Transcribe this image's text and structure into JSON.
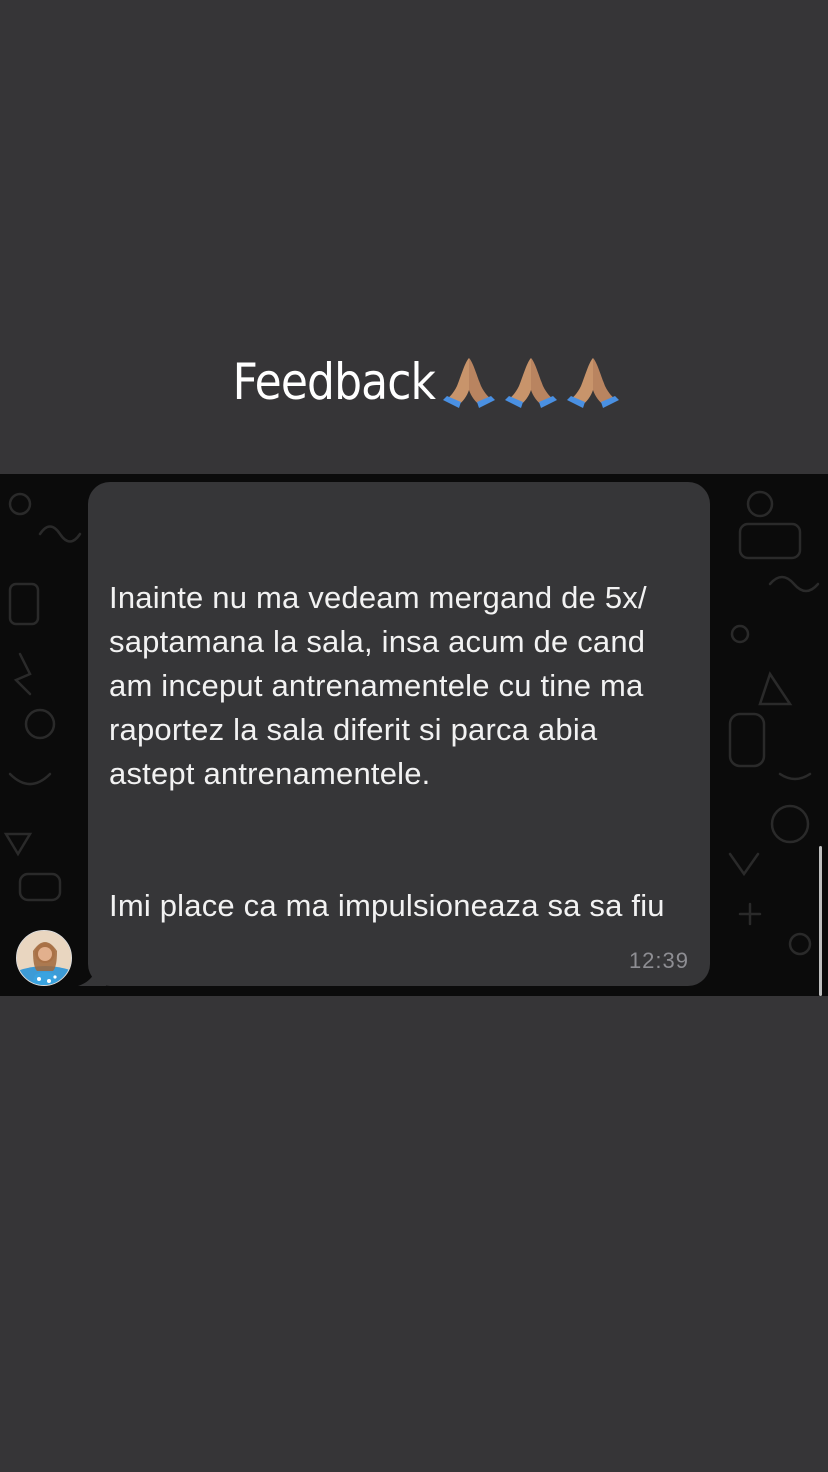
{
  "title": {
    "text": "Feedback",
    "emoji": "🙏🏽🙏🏽🙏🏽",
    "icons": [
      "folded-hands-icon",
      "folded-hands-icon",
      "folded-hands-icon"
    ]
  },
  "message": {
    "paragraphs": [
      "Inainte nu ma vedeam mergand de 5x/\nsaptamana la sala, insa acum de cand\nam inceput antrenamentele cu tine ma\nraportez la sala diferit si parca abia\nastept antrenamentele.",
      "Imi place ca ma impulsioneaza sa sa fiu"
    ],
    "time": "12:39"
  },
  "colors": {
    "page_background": "#363537",
    "chat_background": "#0b0b0b",
    "bubble": "#363638",
    "text": "#f2f2f2",
    "timestamp": "#8e8e93"
  }
}
